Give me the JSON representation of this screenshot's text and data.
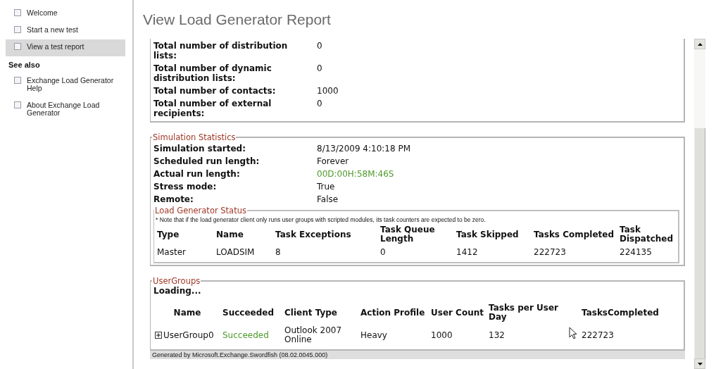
{
  "sidebar": {
    "items": [
      {
        "label": "Welcome",
        "selected": false
      },
      {
        "label": "Start a new test",
        "selected": false
      },
      {
        "label": "View a test report",
        "selected": true
      }
    ],
    "see_also": {
      "heading": "See also",
      "items": [
        "Exchange Load Generator Help",
        "About Exchange Load Generator"
      ]
    }
  },
  "title": "View Load Generator Report",
  "totals": {
    "rows": [
      {
        "label": "Total number of distribution lists:",
        "value": "0"
      },
      {
        "label": "Total number of dynamic distribution lists:",
        "value": "0"
      },
      {
        "label": "Total number of contacts:",
        "value": "1000"
      },
      {
        "label": "Total number of external recipients:",
        "value": "0"
      }
    ]
  },
  "simulation": {
    "legend": "Simulation Statistics",
    "rows": [
      {
        "label": "Simulation started:",
        "value": "8/13/2009 4:10:18 PM"
      },
      {
        "label": "Scheduled run length:",
        "value": "Forever"
      },
      {
        "label": "Actual run length:",
        "value": "00D:00H:58M:46S",
        "color": "#4e9a2c"
      },
      {
        "label": "Stress mode:",
        "value": "True"
      },
      {
        "label": "Remote:",
        "value": "False"
      }
    ],
    "load_generator_status": {
      "legend": "Load Generator Status",
      "note": "* Note that if the load generator client only runs user groups with scripted modules, its task counters are expected to be zero.",
      "columns": [
        "Type",
        "Name",
        "Task Exceptions",
        "Task Queue Length",
        "Task Skipped",
        "Tasks Completed",
        "Task Dispatched"
      ],
      "rows": [
        [
          "Master",
          "LOADSIM",
          "8",
          "0",
          "1412",
          "222723",
          "224135"
        ]
      ]
    }
  },
  "user_groups": {
    "legend": "UserGroups",
    "loading": "Loading...",
    "columns": [
      "Name",
      "Succeeded",
      "Client Type",
      "Action Profile",
      "User Count",
      "Tasks per User Day",
      "TasksCompleted"
    ],
    "rows": [
      {
        "expanded": false,
        "name": "UserGroup0",
        "status": "Succeeded",
        "color": "#4e9a2c",
        "client_type": "Outlook 2007 Online",
        "action_profile": "Heavy",
        "user_count": "1000",
        "tasks_per_user_day": "132",
        "tasks_completed": "222723"
      }
    ]
  },
  "footer": "Generated by Microsoft.Exchange.Swordfish (08.02.0045.000)"
}
